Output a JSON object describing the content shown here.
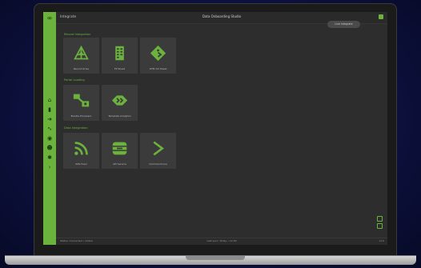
{
  "app": {
    "name": "Integrate",
    "page_title": "Data Onboarding Studio",
    "top_pill": "Live Integrate"
  },
  "sections": [
    {
      "title": "Record Integration",
      "tiles": [
        {
          "label": "Record Drive",
          "icon": "tent-icon"
        },
        {
          "label": "FP Sheet",
          "icon": "sheet-icon"
        },
        {
          "label": "OTM CD Sheet",
          "icon": "diamond-icon"
        }
      ]
    },
    {
      "title": "Portal Loading",
      "tiles": [
        {
          "label": "Bundle Processor",
          "icon": "flow-icon"
        },
        {
          "label": "Template Analytics",
          "icon": "chevrons-icon"
        }
      ]
    },
    {
      "title": "Data Integration",
      "tiles": [
        {
          "label": "RSS Feed",
          "icon": "rss-icon"
        },
        {
          "label": "API Service",
          "icon": "server-icon"
        },
        {
          "label": "Command Line",
          "icon": "prompt-icon"
        }
      ]
    }
  ],
  "status": {
    "left": "Status: Connected • Online",
    "center": "Last sync: Today • 12:00",
    "right": "v1.0"
  },
  "colors": {
    "accent": "#6bb33d",
    "background": "#2d2d2d",
    "tile": "#3b3b3b"
  },
  "sidebar": {
    "icons": [
      "home-icon",
      "file-icon",
      "arrow-icon",
      "link-icon",
      "eye-icon",
      "users-icon",
      "gear-icon",
      "terminal-icon"
    ]
  }
}
